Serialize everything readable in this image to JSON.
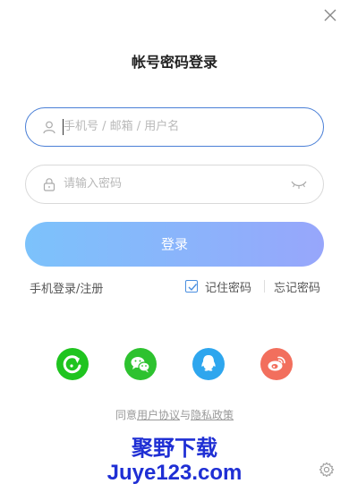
{
  "dialog": {
    "title": "帐号密码登录",
    "close_icon": "close-icon"
  },
  "form": {
    "username_placeholder": "手机号 / 邮箱 / 用户名",
    "password_placeholder": "请输入密码",
    "login_label": "登录"
  },
  "links": {
    "phone_login": "手机登录/注册",
    "remember_password": "记住密码",
    "remember_checked": true,
    "forgot_password": "忘记密码"
  },
  "social": [
    {
      "icon": "refresh-app-icon",
      "color": "#1fc41f"
    },
    {
      "icon": "wechat-icon",
      "color": "#2dc22f"
    },
    {
      "icon": "qq-icon",
      "color": "#2ea6ee"
    },
    {
      "icon": "weibo-icon",
      "color": "#f26f5d"
    }
  ],
  "agreement": {
    "prefix": "同意",
    "user_agreement": "用户协议",
    "and": "与",
    "privacy_policy": "隐私政策"
  },
  "watermark": {
    "line1": "聚野下载",
    "line2": "Juye123.com"
  },
  "colors": {
    "accent": "#4a7fd6",
    "button_gradient_start": "#7cc2fb",
    "button_gradient_end": "#97a6fb"
  }
}
